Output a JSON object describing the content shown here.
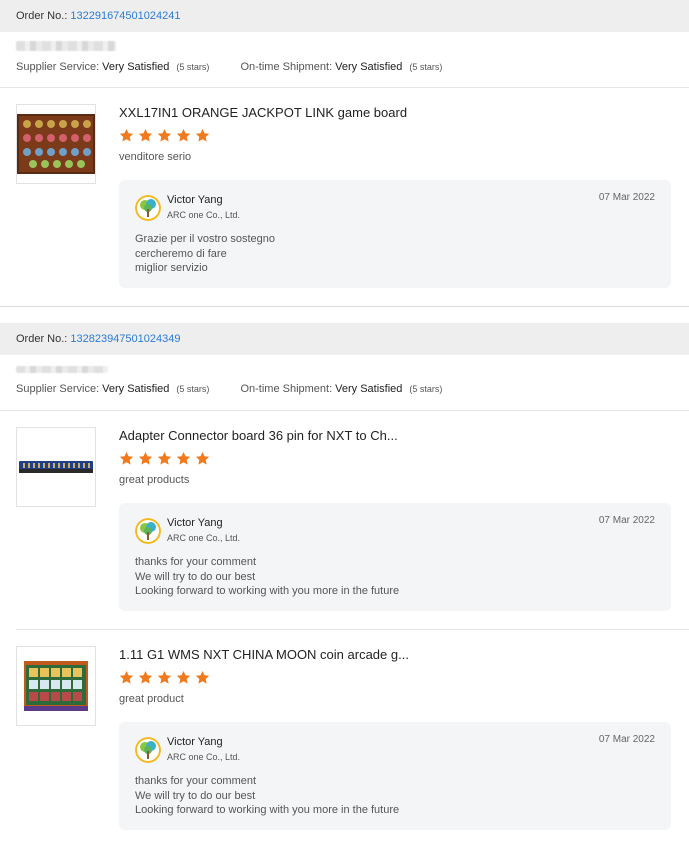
{
  "order_label": "Order No.:",
  "labels": {
    "supplier_service": "Supplier Service:",
    "ontime_shipment": "On-time Shipment:"
  },
  "orders": [
    {
      "order_no": "132291674501024241",
      "supplier_service_value": "Very Satisfied",
      "supplier_service_stars": "(5 stars)",
      "shipment_value": "Very Satisfied",
      "shipment_stars": "(5 stars)",
      "products": [
        {
          "title": "XXL17IN1 ORANGE JACKPOT LINK game board",
          "rating": 5,
          "comment": "venditore serio",
          "reply": {
            "name": "Victor Yang",
            "company": "ARC one Co., Ltd.",
            "date": "07 Mar 2022",
            "lines": [
              "Grazie per il vostro sostegno",
              "cercheremo di fare",
              "miglior servizio"
            ]
          }
        }
      ]
    },
    {
      "order_no": "132823947501024349",
      "supplier_service_value": "Very Satisfied",
      "supplier_service_stars": "(5 stars)",
      "shipment_value": "Very Satisfied",
      "shipment_stars": "(5 stars)",
      "products": [
        {
          "title": "Adapter Connector board 36 pin for NXT to Ch...",
          "rating": 5,
          "comment": "great products",
          "reply": {
            "name": "Victor Yang",
            "company": "ARC one Co., Ltd.",
            "date": "07 Mar 2022",
            "lines": [
              "thanks for your comment",
              "We will try to do our best",
              "Looking forward to working with you more in the future"
            ]
          }
        },
        {
          "title": "1.11 G1 WMS NXT CHINA MOON coin arcade g...",
          "rating": 5,
          "comment": "great product",
          "reply": {
            "name": "Victor Yang",
            "company": "ARC one Co., Ltd.",
            "date": "07 Mar 2022",
            "lines": [
              "thanks for your comment",
              "We will try to do our best",
              "Looking forward to working with you more in the future"
            ]
          }
        }
      ]
    }
  ],
  "colors": {
    "link": "#2b7bd3",
    "star": "#f07b1e",
    "header_bg": "#eeeeee",
    "reply_bg": "#f4f5f7"
  },
  "icons": {
    "star": "star-icon",
    "avatar": "tree-logo-avatar"
  }
}
